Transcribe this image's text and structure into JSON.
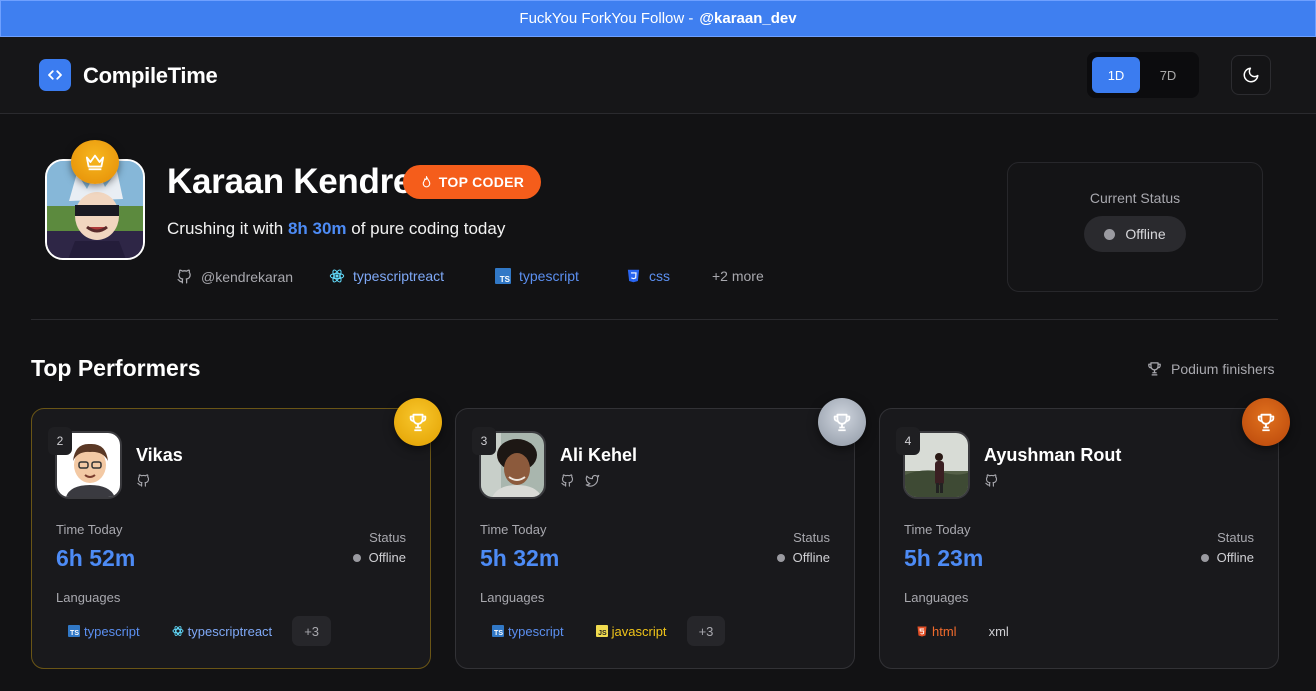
{
  "banner": {
    "text": "FuckYou ForkYou Follow -",
    "handle": "@karaan_dev"
  },
  "app": {
    "name": "CompileTime"
  },
  "range": {
    "options": [
      "1D",
      "7D"
    ],
    "selected": "1D"
  },
  "profile": {
    "name": "Karaan Kendre",
    "badge": "TOP CODER",
    "tagline_pre": "Crushing it with",
    "tagline_time": "8h 30m",
    "tagline_post": "of pure coding today",
    "github": "@kendrekaran",
    "languages": [
      "typescriptreact",
      "typescript",
      "css"
    ],
    "more": "+2 more"
  },
  "current_status": {
    "label": "Current Status",
    "value": "Offline"
  },
  "section": {
    "title": "Top Performers",
    "podium_label": "Podium finishers"
  },
  "performers": [
    {
      "rank": "2",
      "name": "Vikas",
      "time_label": "Time Today",
      "time": "6h 52m",
      "status_label": "Status",
      "status": "Offline",
      "languages_label": "Languages",
      "languages": [
        "typescript",
        "typescriptreact"
      ],
      "more": "+3",
      "trophy_color": "#eab308"
    },
    {
      "rank": "3",
      "name": "Ali Kehel",
      "time_label": "Time Today",
      "time": "5h 32m",
      "status_label": "Status",
      "status": "Offline",
      "languages_label": "Languages",
      "languages": [
        "typescript",
        "javascript"
      ],
      "more": "+3",
      "trophy_color": "#9ca3af"
    },
    {
      "rank": "4",
      "name": "Ayushman Rout",
      "time_label": "Time Today",
      "time": "5h 23m",
      "status_label": "Status",
      "status": "Offline",
      "languages_label": "Languages",
      "languages": [
        "html",
        "xml"
      ],
      "more": "",
      "trophy_color": "#c2410c"
    }
  ],
  "colors": {
    "accent": "#3b7cf0",
    "badge": "#f55d1b",
    "highlight": "#4d8bf5"
  }
}
